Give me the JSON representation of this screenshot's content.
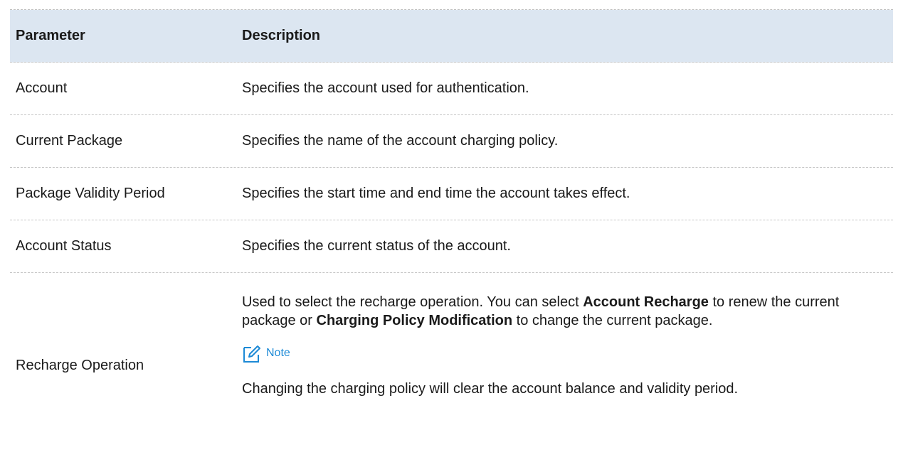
{
  "table": {
    "header": {
      "parameter": "Parameter",
      "description": "Description"
    },
    "rows": [
      {
        "parameter": "Account",
        "description": "Specifies the account used for authentication."
      },
      {
        "parameter": "Current Package",
        "description": "Specifies the name of the account charging policy."
      },
      {
        "parameter": "Package Validity Period",
        "description": "Specifies the start time and end time the account takes effect."
      },
      {
        "parameter": "Account Status",
        "description": "Specifies the current status of the account."
      },
      {
        "parameter": "Recharge Operation",
        "desc_part1": "Used to select the recharge operation. You can select ",
        "desc_bold1": "Account Recharge",
        "desc_part2": " to renew the current package or ",
        "desc_bold2": "Charging Policy Modification",
        "desc_part3": " to change the current package.",
        "note_label": "Note",
        "note_text": "Changing the charging policy will clear the account balance and validity period."
      }
    ]
  },
  "colors": {
    "header_bg": "#dce6f1",
    "note_accent": "#1d8ad6"
  },
  "icons": {
    "note": "edit-note-icon"
  }
}
